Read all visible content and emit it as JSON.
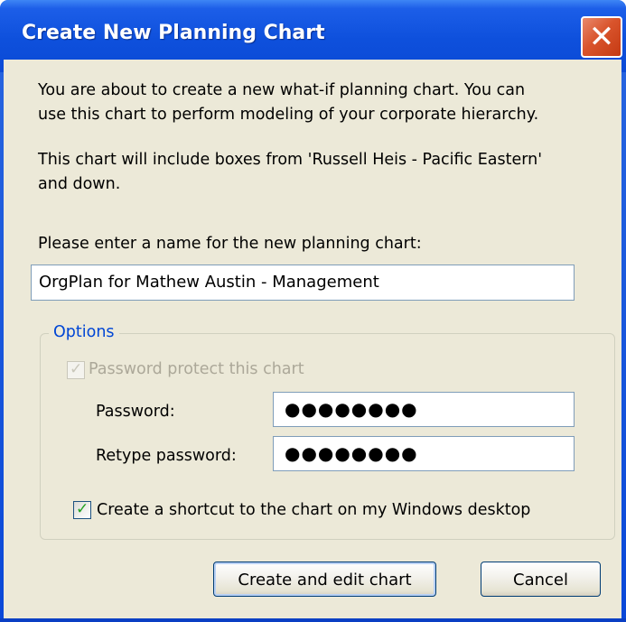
{
  "dialog": {
    "title": "Create New Planning Chart",
    "close_glyph": "✕",
    "intro_line1": "You are about to create a new what-if planning chart. You can",
    "intro_line2": "use this chart to perform modeling of your corporate hierarchy.",
    "scope_line1": "This chart will include boxes from 'Russell Heis - Pacific Eastern'",
    "scope_line2": "and down.",
    "name_prompt": "Please enter a name for the new planning chart:",
    "name_value": "OrgPlan for Mathew Austin - Management"
  },
  "options": {
    "group_label": "Options",
    "password_protect": {
      "label": "Password protect this chart",
      "checked": true,
      "enabled": false
    },
    "password_label": "Password:",
    "password_value": "●●●●●●●●",
    "retype_label": "Retype password:",
    "retype_value": "●●●●●●●●",
    "shortcut": {
      "label": "Create a shortcut to the chart on my Windows desktop",
      "checked": true,
      "enabled": true
    }
  },
  "buttons": {
    "create_label": "Create and edit chart",
    "cancel_label": "Cancel"
  },
  "icons": {
    "close": "close-icon",
    "check": "checkmark-icon"
  },
  "colors": {
    "titlebar": "#0b4ad6",
    "dialog_bg": "#ece9d8",
    "group_label": "#0046d5",
    "close_button": "#d9542c"
  }
}
